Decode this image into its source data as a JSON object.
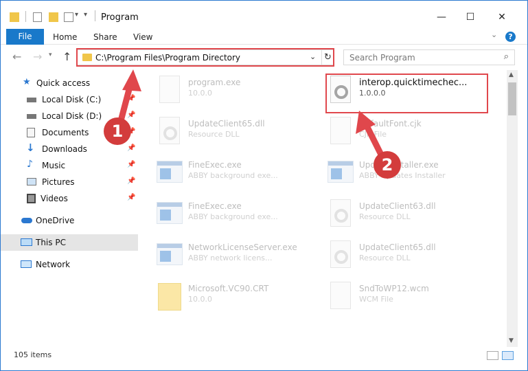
{
  "window": {
    "title": "Program"
  },
  "ribbon": {
    "tabs": [
      "File",
      "Home",
      "Share",
      "View"
    ],
    "help_label": "?"
  },
  "address": {
    "path": "C:\\Program Files\\Program Directory"
  },
  "search": {
    "placeholder": "Search Program"
  },
  "sidebar": {
    "items": [
      {
        "label": "Quick access",
        "icon": "star-icon"
      },
      {
        "label": "Local Disk (C:)",
        "icon": "drive-icon",
        "pinned": true
      },
      {
        "label": "Local Disk (D:)",
        "icon": "drive-icon",
        "pinned": true
      },
      {
        "label": "Documents",
        "icon": "documents-icon",
        "pinned": true
      },
      {
        "label": "Downloads",
        "icon": "download-icon",
        "pinned": true
      },
      {
        "label": "Music",
        "icon": "music-icon",
        "pinned": true
      },
      {
        "label": "Pictures",
        "icon": "pictures-icon",
        "pinned": true
      },
      {
        "label": "Videos",
        "icon": "videos-icon",
        "pinned": true
      },
      {
        "label": "OneDrive",
        "icon": "cloud-icon"
      },
      {
        "label": "This PC",
        "icon": "computer-icon",
        "selected": true
      },
      {
        "label": "Network",
        "icon": "network-icon"
      }
    ]
  },
  "files": [
    {
      "name": "program.exe",
      "sub": "10.0.0"
    },
    {
      "name": "interop.quicktimechec...",
      "sub": "1.0.0.0",
      "active": true
    },
    {
      "name": "UpdateClient65.dll",
      "sub": "Resource DLL"
    },
    {
      "name": "DefaultFont.cjk",
      "sub": "CJK File"
    },
    {
      "name": "FineExec.exe",
      "sub": "ABBY background exe..."
    },
    {
      "name": "Updateinstaller.exe",
      "sub": "ABBY Updates Installer"
    },
    {
      "name": "FineExec.exe",
      "sub": "ABBY background exe..."
    },
    {
      "name": "UpdateClient63.dll",
      "sub": "Resource DLL"
    },
    {
      "name": "NetworkLicenseServer.exe",
      "sub": "ABBY network licens..."
    },
    {
      "name": "UpdateClient65.dll",
      "sub": "Resource DLL"
    },
    {
      "name": "Microsoft.VC90.CRT",
      "sub": "10.0.0"
    },
    {
      "name": "SndToWP12.wcm",
      "sub": "WCM File"
    }
  ],
  "annotations": {
    "badge_1": "1",
    "badge_2": "2",
    "color": "#e0474c"
  },
  "status": {
    "item_count": "105 items"
  },
  "colors": {
    "accent": "#1979ca",
    "highlight": "#e0474c"
  }
}
